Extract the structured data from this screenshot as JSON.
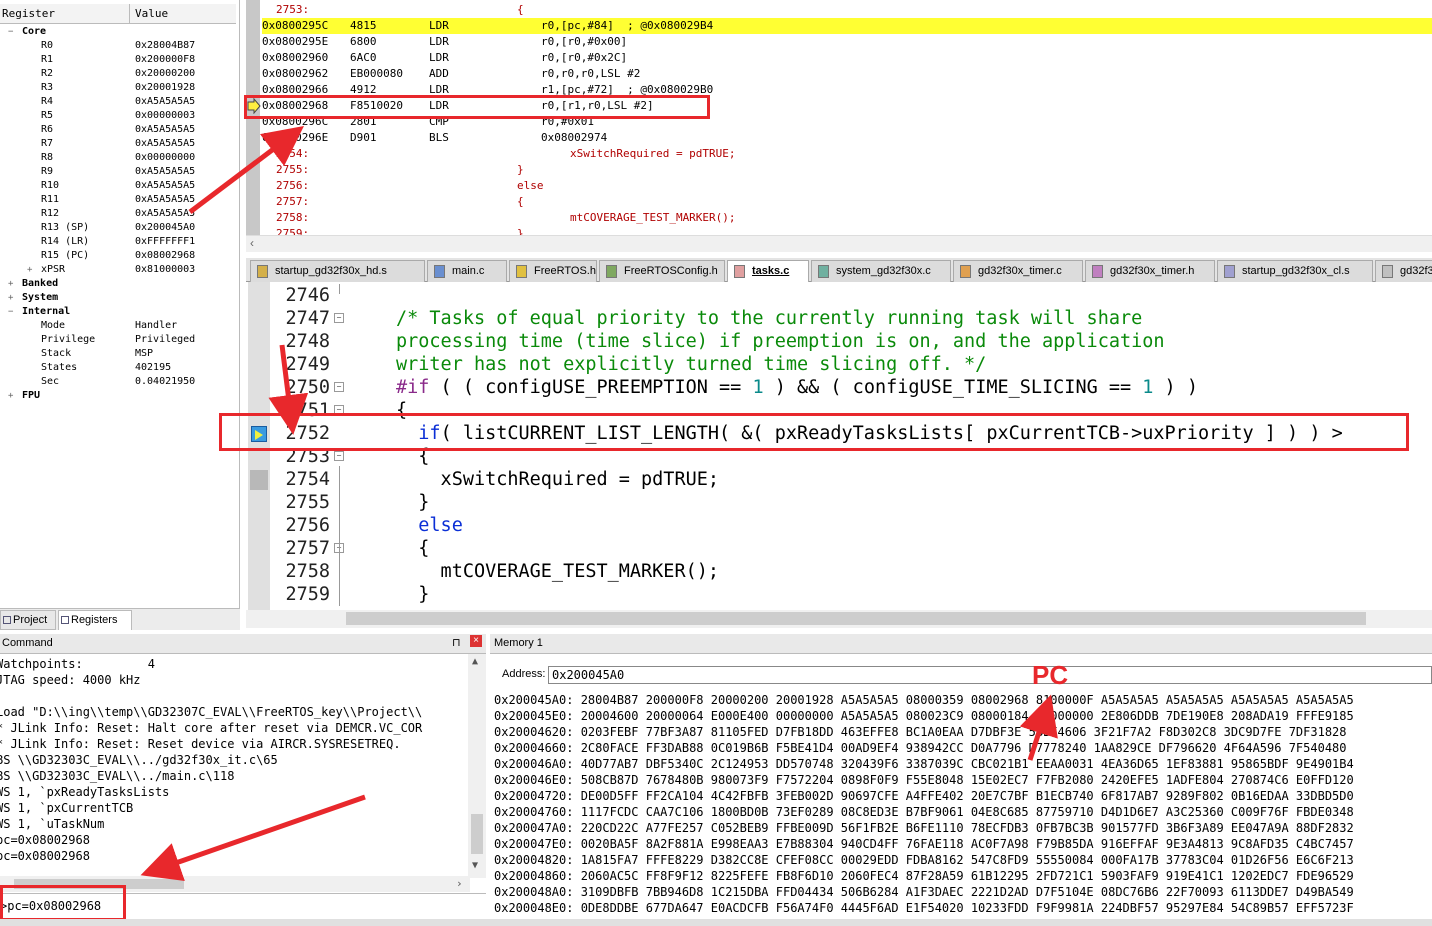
{
  "registers": {
    "header": {
      "col_register": "Register",
      "col_value": "Value"
    },
    "groups": {
      "core": "Core",
      "banked": "Banked",
      "system": "System",
      "internal": "Internal",
      "fpu": "FPU"
    },
    "core": [
      {
        "name": "R0",
        "value": "0x28004B87"
      },
      {
        "name": "R1",
        "value": "0x200000F8"
      },
      {
        "name": "R2",
        "value": "0x20000200"
      },
      {
        "name": "R3",
        "value": "0x20001928"
      },
      {
        "name": "R4",
        "value": "0xA5A5A5A5"
      },
      {
        "name": "R5",
        "value": "0x00000003"
      },
      {
        "name": "R6",
        "value": "0xA5A5A5A5"
      },
      {
        "name": "R7",
        "value": "0xA5A5A5A5"
      },
      {
        "name": "R8",
        "value": "0x00000000"
      },
      {
        "name": "R9",
        "value": "0xA5A5A5A5"
      },
      {
        "name": "R10",
        "value": "0xA5A5A5A5"
      },
      {
        "name": "R11",
        "value": "0xA5A5A5A5"
      },
      {
        "name": "R12",
        "value": "0xA5A5A5A5"
      },
      {
        "name": "R13 (SP)",
        "value": "0x200045A0"
      },
      {
        "name": "R14 (LR)",
        "value": "0xFFFFFFF1"
      },
      {
        "name": "R15 (PC)",
        "value": "0x08002968"
      },
      {
        "name": "xPSR",
        "value": "0x81000003"
      }
    ],
    "internal": [
      {
        "name": "Mode",
        "value": "Handler"
      },
      {
        "name": "Privilege",
        "value": "Privileged"
      },
      {
        "name": "Stack",
        "value": "MSP"
      },
      {
        "name": "States",
        "value": "402195"
      },
      {
        "name": "Sec",
        "value": "0.04021950"
      }
    ],
    "tabs": {
      "project": "Project",
      "registers": "Registers"
    }
  },
  "disassembly": {
    "lines": [
      {
        "kind": "src",
        "ln": "2753:",
        "text": "{"
      },
      {
        "kind": "asm",
        "addr": "0x0800295C",
        "hex": "4815",
        "op": "LDR",
        "args": "r0,[pc,#84]  ; @0x080029B4"
      },
      {
        "kind": "asm",
        "addr": "0x0800295E",
        "hex": "6800",
        "op": "LDR",
        "args": "r0,[r0,#0x00]"
      },
      {
        "kind": "asm",
        "addr": "0x08002960",
        "hex": "6AC0",
        "op": "LDR",
        "args": "r0,[r0,#0x2C]"
      },
      {
        "kind": "asm",
        "addr": "0x08002962",
        "hex": "EB000080",
        "op": "ADD",
        "args": "r0,r0,r0,LSL #2"
      },
      {
        "kind": "asm",
        "addr": "0x08002966",
        "hex": "4912",
        "op": "LDR",
        "args": "r1,[pc,#72]  ; @0x080029B0"
      },
      {
        "kind": "asm",
        "addr": "0x08002968",
        "hex": "F8510020",
        "op": "LDR",
        "args": "r0,[r1,r0,LSL #2]"
      },
      {
        "kind": "asm",
        "addr": "0x0800296C",
        "hex": "2801",
        "op": "CMP",
        "args": "r0,#0x01"
      },
      {
        "kind": "asm",
        "addr": "0x0800296E",
        "hex": "D901",
        "op": "BLS",
        "args": "0x08002974"
      },
      {
        "kind": "src",
        "ln": "2754:",
        "text": "        xSwitchRequired = pdTRUE;"
      },
      {
        "kind": "src",
        "ln": "2755:",
        "text": "}"
      },
      {
        "kind": "src",
        "ln": "2756:",
        "text": "else"
      },
      {
        "kind": "src",
        "ln": "2757:",
        "text": "{"
      },
      {
        "kind": "src",
        "ln": "2758:",
        "text": "        mtCOVERAGE_TEST_MARKER();"
      },
      {
        "kind": "src",
        "ln": "2759:",
        "text": "}"
      }
    ]
  },
  "file_tabs": [
    {
      "label": "startup_gd32f30x_hd.s",
      "color": "#d4b04a"
    },
    {
      "label": "main.c",
      "color": "#6a8fd0"
    },
    {
      "label": "FreeRTOS.h",
      "color": "#e0c040"
    },
    {
      "label": "FreeRTOSConfig.h",
      "color": "#7fa860"
    },
    {
      "label": "tasks.c",
      "color": "#e0a0a0"
    },
    {
      "label": "system_gd32f30x.c",
      "color": "#70b0a0"
    },
    {
      "label": "gd32f30x_timer.c",
      "color": "#e0a050"
    },
    {
      "label": "gd32f30x_timer.h",
      "color": "#c080c0"
    },
    {
      "label": "startup_gd32f30x_cl.s",
      "color": "#a0a0d0"
    },
    {
      "label": "gd32f3",
      "color": "#c0c0c0"
    }
  ],
  "editor": {
    "lines": [
      {
        "n": "2746",
        "html": ""
      },
      {
        "n": "2747",
        "html": "<span class=\"cm\">/* Tasks of equal priority to the currently running task will share</span>"
      },
      {
        "n": "2748",
        "html": "<span class=\"cm\">processing time (time slice) if preemption is on, and the application</span>"
      },
      {
        "n": "2749",
        "html": "<span class=\"cm\">writer has not explicitly turned time slicing off. */</span>"
      },
      {
        "n": "2750",
        "html": "<span class=\"pp\">#if</span> ( ( configUSE_PREEMPTION == <span class=\"nm\">1</span> ) &amp;&amp; ( configUSE_TIME_SLICING == <span class=\"nm\">1</span> ) )"
      },
      {
        "n": "2751",
        "html": "{"
      },
      {
        "n": "2752",
        "html": "  <span class=\"kw\">if</span>( listCURRENT_LIST_LENGTH( &amp;( pxReadyTasksLists[ pxCurrentTCB-&gt;uxPriority ] ) ) &gt;"
      },
      {
        "n": "2753",
        "html": "  {"
      },
      {
        "n": "2754",
        "html": "    xSwitchRequired = pdTRUE;"
      },
      {
        "n": "2755",
        "html": "  }"
      },
      {
        "n": "2756",
        "html": "  <span class=\"kw\">else</span>"
      },
      {
        "n": "2757",
        "html": "  {"
      },
      {
        "n": "2758",
        "html": "    mtCOVERAGE_TEST_MARKER();"
      },
      {
        "n": "2759",
        "html": "  }"
      }
    ]
  },
  "command": {
    "title": "Command",
    "lines": [
      "Watchpoints:         4",
      "JTAG speed: 4000 kHz",
      "",
      "Load \"D:\\\\ing\\\\temp\\\\GD32307C_EVAL\\\\FreeRTOS_key\\\\Project\\\\",
      "* JLink Info: Reset: Halt core after reset via DEMCR.VC_COR",
      "* JLink Info: Reset: Reset device via AIRCR.SYSRESETREQ.",
      "BS \\\\GD32303C_EVAL\\\\../gd32f30x_it.c\\65",
      "BS \\\\GD32303C_EVAL\\\\../main.c\\118",
      "WS 1, `pxReadyTasksLists",
      "WS 1, `pxCurrentTCB",
      "WS 1, `uTaskNum",
      "pc=0x08002968",
      "pc=0x08002968"
    ],
    "input": ">pc=0x08002968"
  },
  "memory": {
    "title": "Memory 1",
    "address_label": "Address:",
    "address_value": "0x200045A0",
    "annotation": "PC",
    "rows": [
      "0x200045A0: 28004B87 200000F8 20000200 20001928 A5A5A5A5 08000359 08002968 8100000F A5A5A5A5 A5A5A5A5 A5A5A5A5 A5A5A5A5",
      "0x200045E0: 20004600 20000064 E000E400 00000000 A5A5A5A5 080023C9 08000184 61000000 2E806DDB 7DE190E8 208ADA19 FFFE9185",
      "0x20004620: 0203FEBF 77BF3A87 81105FED D7FB18DD 463EFFE8 BC1A0EAA D7DBF3E 5BBE4606 3F21F7A2 F8D302C8 3DC9D7FE 7DF31828",
      "0x20004660: 2C80FACE FF3DAB88 0C019B6B F5BE41D4 00AD9EF4 938942CC D0A7796 D7778240 1AA829CE DF796620 4F64A596 7F540480",
      "0x200046A0: 40D77AB7 DBF5340C 2C124953 DD570748 320439F6 3387039C CBC021B1 EEAA0031 4EA36D65 1EF83881 95865BDF 9E4901B4",
      "0x200046E0: 508CB87D 7678480B 980073F9 F7572204 0898F0F9 F55E8048 15E02EC7 F7FB2080 2420EFE5 1ADFE804 270874C6 E0FFD120",
      "0x20004720: DE00D5FF FF2CA104 4C42FBFB 3FEB002D 90697CFE A4FFE402 20E7C7BF B1ECB740 6F817AB7 9289F802 0B16EDAA 33DBD5D0",
      "0x20004760: 1117FCDC CAA7C106 1800BD0B 73EF0289 08C8ED3E B7BF9061 04E8C685 87759710 D4D1D6E7 A3C25360 C009F76F FBDE0348",
      "0x200047A0: 220CD22C A77FE257 C052BEB9 FFBE009D 56F1FB2E B6FE1110 78ECFDB3 0FB7BC3B 901577FD 3B6F3A89 EE047A9A 88DF2832",
      "0x200047E0: 0020BA5F 8A2F881A E998EAA3 E7B88304 940CD4FF 76FAE118 AC0F7A98 F79B85DA 916EFFAF 9E3A4813 9C8AFD35 C4BC7457",
      "0x20004820: 1A815FA7 FFFE8229 D382CC8E CFEF08CC 00029EDD FDBA8162 547C8FD9 55550084 000FA17B 37783C04 01D26F56 E6C6F213",
      "0x20004860: 2060AC5C FF8F9F12 8225FEFE FB8F6D10 2060FEC4 87F28A59 61B12295 2FD721C1 5903FAF9 919E41C1 1202EDC7 FDE96529",
      "0x200048A0: 3109DBFB 7BB946D8 1C215DBA FFD04434 506B6284 A1F3DAEC 2221D2AD D7F5104E 08DC76B6 22F70093 6113DDE7 D49BA549",
      "0x200048E0: 0DE8DDBE 677DA647 E0ACDCFB F56A74F0 4445F6AD E1F54020 10233FDD F9F9981A 224DBF57 95297E84 54C89B57 EFF5723F"
    ]
  },
  "colors": {
    "highlight_line": "#ffff33",
    "annotation_red": "#e8282c",
    "comment_green": "#0a8a0a",
    "keyword_blue": "#0b2fd6"
  }
}
